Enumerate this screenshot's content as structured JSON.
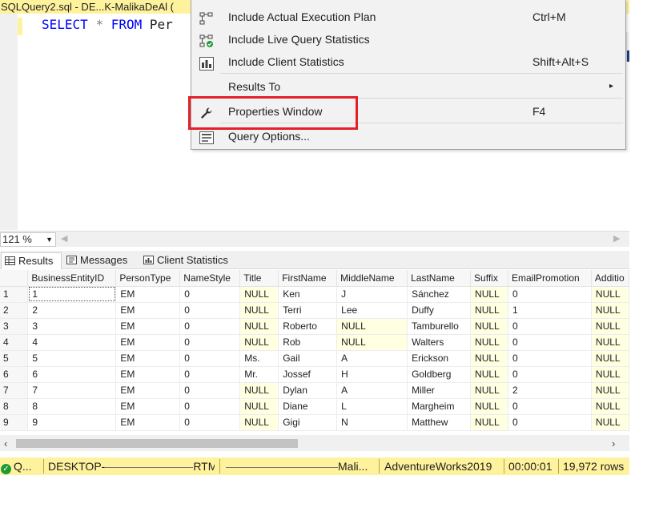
{
  "document_tab": {
    "title": "SQLQuery2.sql - DE...K-MalikaDeAl ("
  },
  "editor": {
    "sql": {
      "kw_select": "SELECT",
      "star": "*",
      "kw_from": "FROM",
      "table_partial": "Per"
    }
  },
  "context_menu": {
    "items": [
      {
        "label": "Include Actual Execution Plan",
        "shortcut": "Ctrl+M",
        "icon": "execution-plan-icon"
      },
      {
        "label": "Include Live Query Statistics",
        "shortcut": "",
        "icon": "live-statistics-icon"
      },
      {
        "label": "Include Client Statistics",
        "shortcut": "Shift+Alt+S",
        "icon": "client-statistics-icon"
      },
      {
        "label": "Results To",
        "shortcut": "",
        "icon": "",
        "arrow": "▸"
      },
      {
        "label": "Properties Window",
        "shortcut": "F4",
        "icon": "wrench-icon",
        "highlighted": true
      },
      {
        "label": "Query Options...",
        "shortcut": "",
        "icon": "query-options-icon"
      }
    ]
  },
  "zoom": {
    "value": "121 %"
  },
  "result_tabs": [
    {
      "label": "Results",
      "active": true
    },
    {
      "label": "Messages",
      "active": false
    },
    {
      "label": "Client Statistics",
      "active": false
    }
  ],
  "grid": {
    "columns": [
      "BusinessEntityID",
      "PersonType",
      "NameStyle",
      "Title",
      "FirstName",
      "MiddleName",
      "LastName",
      "Suffix",
      "EmailPromotion",
      "Additio"
    ],
    "rows": [
      [
        "1",
        "1",
        "EM",
        "0",
        "NULL",
        "Ken",
        "J",
        "Sánchez",
        "NULL",
        "0",
        "NULL"
      ],
      [
        "2",
        "2",
        "EM",
        "0",
        "NULL",
        "Terri",
        "Lee",
        "Duffy",
        "NULL",
        "1",
        "NULL"
      ],
      [
        "3",
        "3",
        "EM",
        "0",
        "NULL",
        "Roberto",
        "NULL",
        "Tamburello",
        "NULL",
        "0",
        "NULL"
      ],
      [
        "4",
        "4",
        "EM",
        "0",
        "NULL",
        "Rob",
        "NULL",
        "Walters",
        "NULL",
        "0",
        "NULL"
      ],
      [
        "5",
        "5",
        "EM",
        "0",
        "Ms.",
        "Gail",
        "A",
        "Erickson",
        "NULL",
        "0",
        "NULL"
      ],
      [
        "6",
        "6",
        "EM",
        "0",
        "Mr.",
        "Jossef",
        "H",
        "Goldberg",
        "NULL",
        "0",
        "NULL"
      ],
      [
        "7",
        "7",
        "EM",
        "0",
        "NULL",
        "Dylan",
        "A",
        "Miller",
        "NULL",
        "2",
        "NULL"
      ],
      [
        "8",
        "8",
        "EM",
        "0",
        "NULL",
        "Diane",
        "L",
        "Margheim",
        "NULL",
        "0",
        "NULL"
      ],
      [
        "9",
        "9",
        "EM",
        "0",
        "NULL",
        "Gigi",
        "N",
        "Matthew",
        "NULL",
        "0",
        "NULL"
      ]
    ]
  },
  "status_bar": {
    "status": "Q...",
    "server": "DESKTOP-",
    "version_tail": "RTM)",
    "user_tail": "Mali...",
    "database": "AdventureWorks2019",
    "elapsed": "00:00:01",
    "rows": "19,972 rows"
  },
  "colors": {
    "status_bar": "#fff29d",
    "highlight_box": "#e4202a",
    "keyword": "#0000ff",
    "null_cell": "#ffffe1"
  }
}
